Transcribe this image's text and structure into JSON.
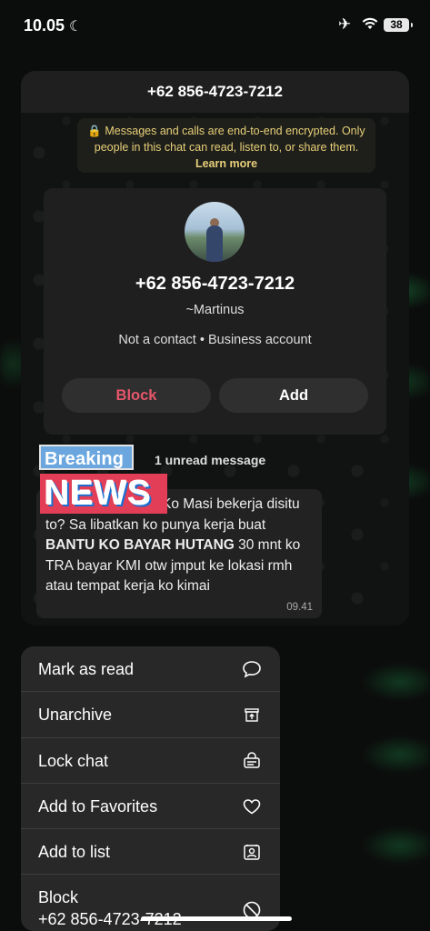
{
  "status_bar": {
    "time": "10.05",
    "battery": "38"
  },
  "chat": {
    "title": "+62 856-4723-7212",
    "encryption_text": "🔒 Messages and calls are end-to-end encrypted. Only people in this chat can read, listen to, or share them.",
    "encryption_link": "Learn more",
    "profile": {
      "number": "+62 856-4723-7212",
      "name": "~Martinus",
      "info": "Not a contact • Business account",
      "block_label": "Block",
      "add_label": "Add"
    },
    "unread_label": "1 unread message",
    "message": {
      "badge_breaking": "Breaking",
      "badge_news": "NEWS",
      "text_1": "Ko Masi bekerja disitu to? Sa libatkan ko punya kerja buat ",
      "text_bold": "BANTU KO BAYAR HUTANG",
      "text_2": " 30 mnt ko TRA bayar KMI otw jmput ke lokasi rmh atau tempat kerja ko kimai",
      "time": "09.41"
    }
  },
  "menu": {
    "items": [
      {
        "label": "Mark as read",
        "icon": "speech-bubble-icon"
      },
      {
        "label": "Unarchive",
        "icon": "unarchive-box-icon"
      },
      {
        "label": "Lock chat",
        "icon": "lock-chat-icon"
      },
      {
        "label": "Add to Favorites",
        "icon": "heart-icon"
      },
      {
        "label": "Add to list",
        "icon": "contact-list-icon"
      },
      {
        "label": "Block",
        "sublabel": "+62 856-4723-7212",
        "icon": "block-icon"
      }
    ]
  }
}
